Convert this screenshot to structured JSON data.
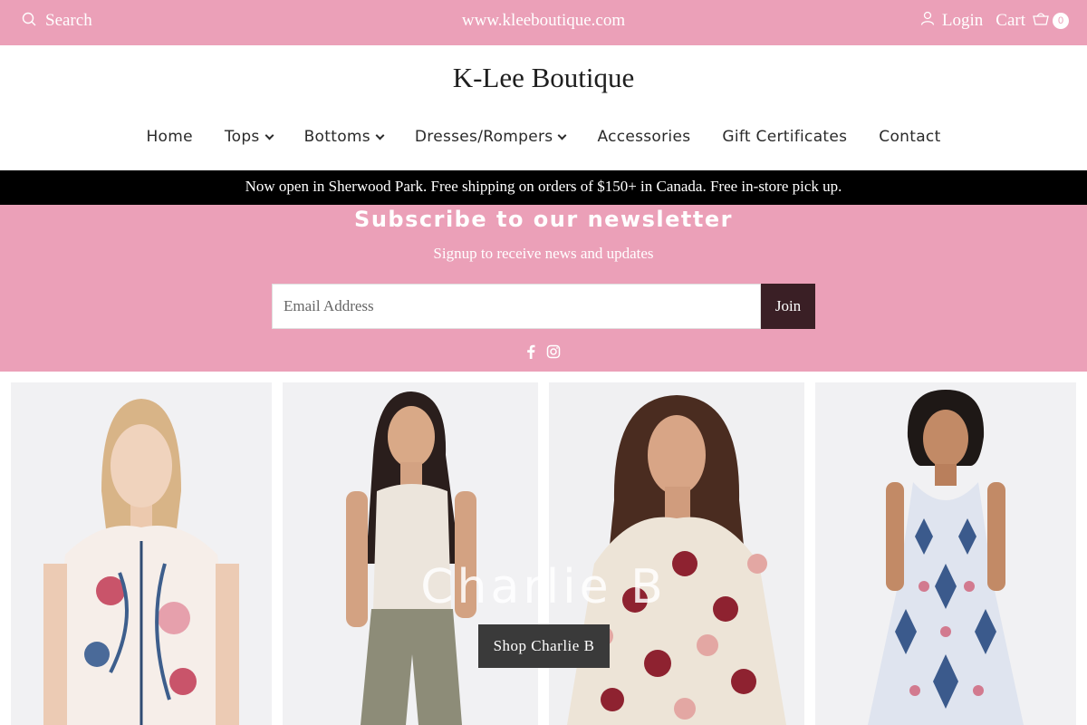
{
  "topbar": {
    "search_label": "Search",
    "site_url": "www.kleeboutique.com",
    "login_label": "Login",
    "cart_label": "Cart",
    "cart_count": "0"
  },
  "logo": "K-Lee Boutique",
  "nav": {
    "items": [
      {
        "label": "Home"
      },
      {
        "label": "Tops"
      },
      {
        "label": "Bottoms"
      },
      {
        "label": "Dresses/Rompers"
      },
      {
        "label": "Accessories"
      },
      {
        "label": "Gift Certificates"
      },
      {
        "label": "Contact"
      }
    ]
  },
  "announcement": "Now open in Sherwood Park. Free shipping on orders of $150+ in Canada. Free in-store pick up.",
  "newsletter": {
    "title": "Subscribe to our newsletter",
    "subtitle": "Signup to receive news and updates",
    "email_placeholder": "Email Address",
    "join_label": "Join"
  },
  "hero": {
    "title": "Charlie B",
    "button_label": "Shop Charlie B"
  },
  "colors": {
    "brand_pink": "#eba0b8",
    "announce_bg": "#000000",
    "join_bg": "#3a1f25"
  }
}
